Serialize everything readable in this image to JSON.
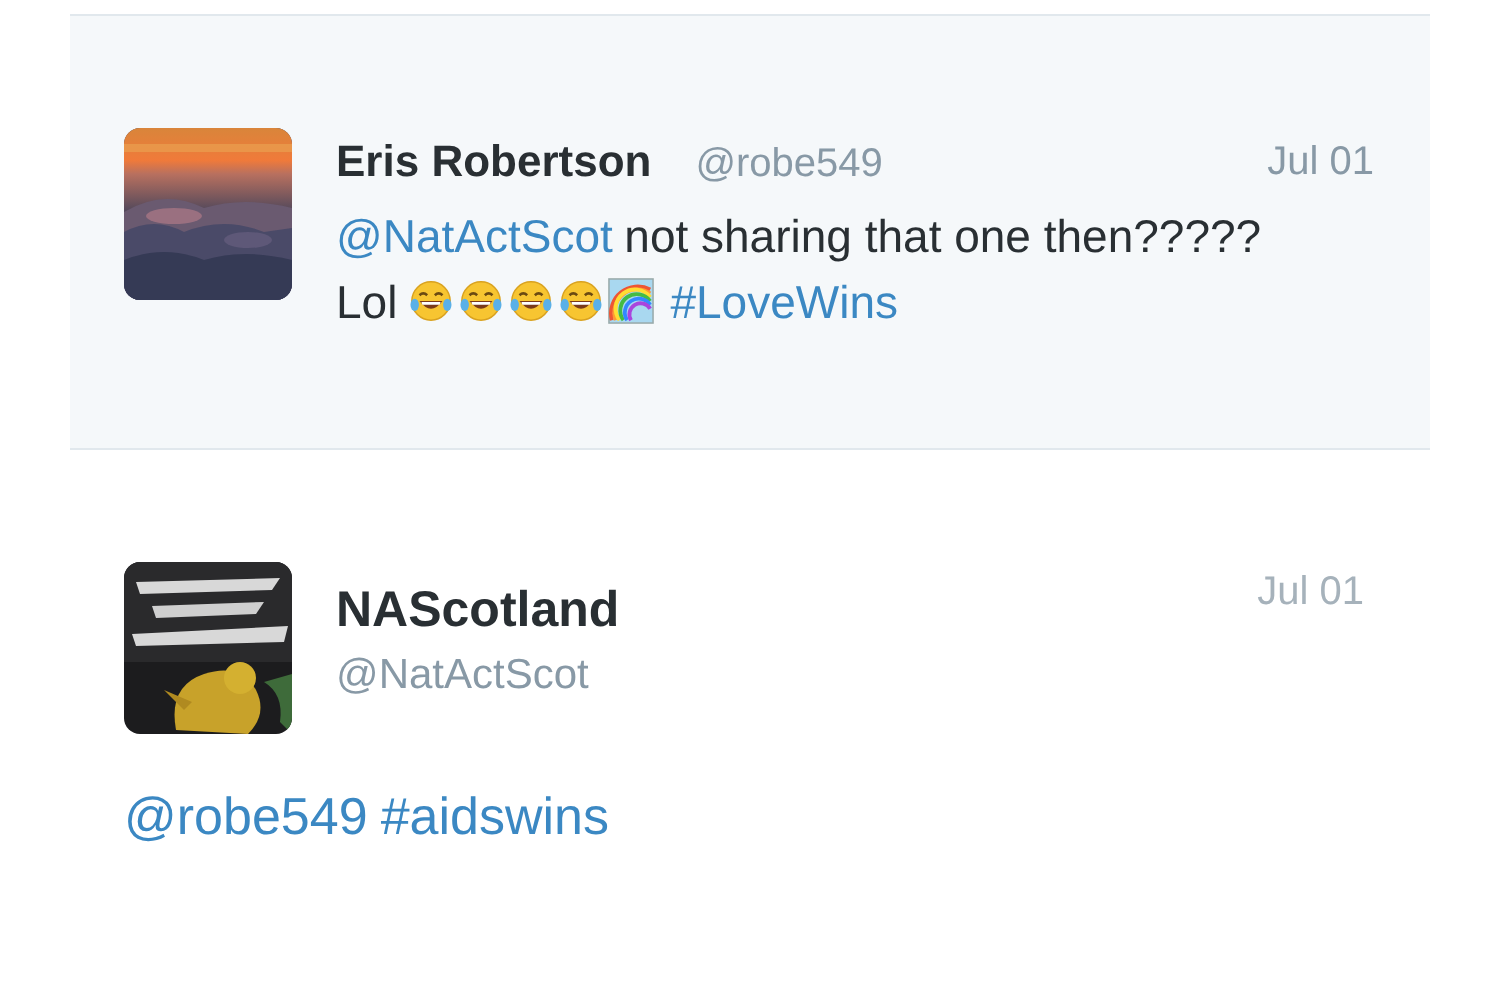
{
  "tweets": [
    {
      "name": "Eris Robertson",
      "handle": "@robe549",
      "date": "Jul 01",
      "highlighted": true,
      "body": [
        {
          "kind": "mention",
          "text": "@NatActScot"
        },
        {
          "kind": "text",
          "text": "not sharing that one then?????"
        },
        {
          "kind": "text",
          "text": "Lol"
        },
        {
          "kind": "laughing"
        },
        {
          "kind": "laughing"
        },
        {
          "kind": "laughing"
        },
        {
          "kind": "laughing"
        },
        {
          "kind": "rainbow"
        },
        {
          "kind": "hashtag",
          "text": "#LoveWins"
        }
      ]
    },
    {
      "name": "NAScotland",
      "handle": "@NatActScot",
      "date": "Jul 01",
      "highlighted": false,
      "body": [
        {
          "kind": "mention",
          "text": "@robe549"
        },
        {
          "kind": "hashtag",
          "text": "#aidswins"
        }
      ]
    }
  ]
}
